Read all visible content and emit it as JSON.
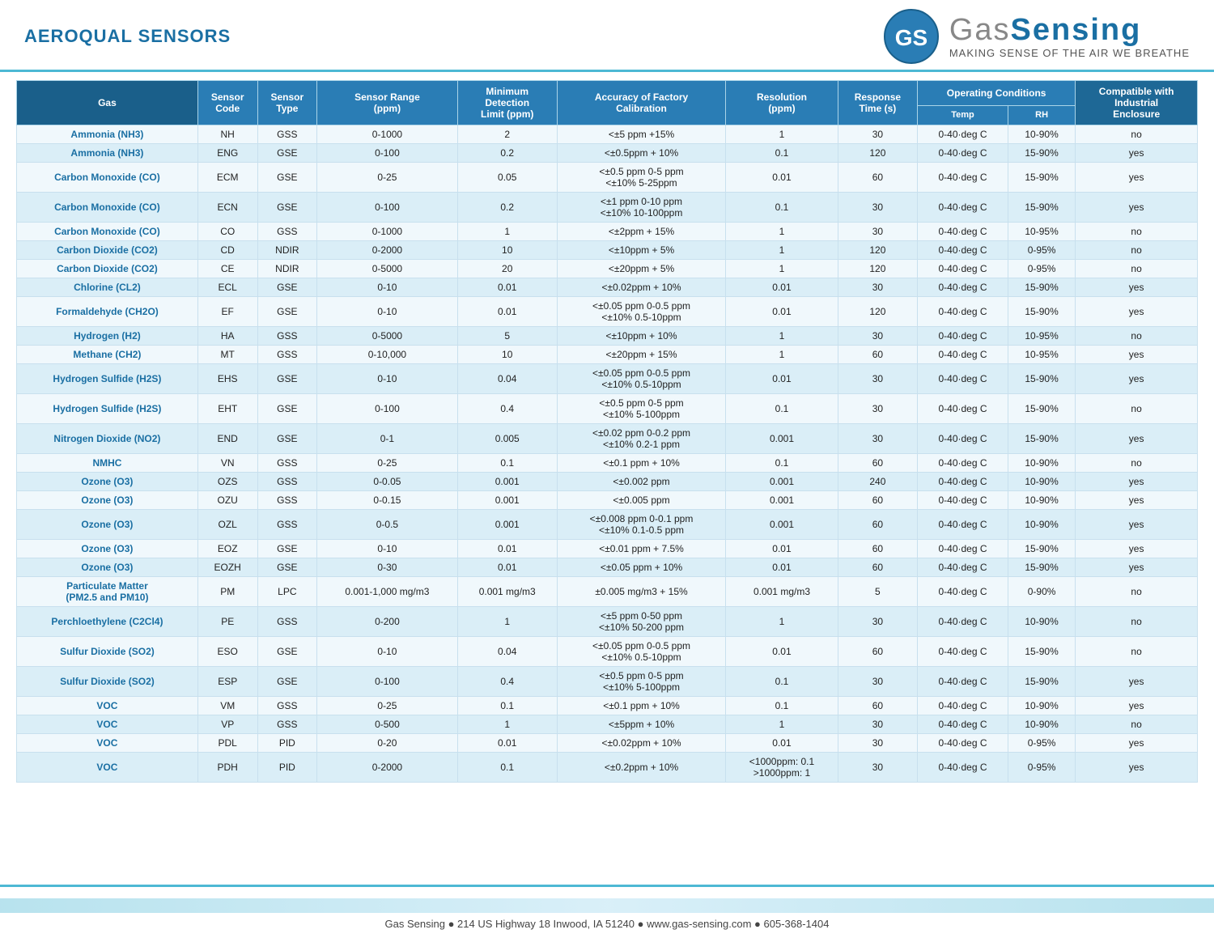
{
  "header": {
    "brand_title": "AEROQUAL SENSORS",
    "logo_gas": "Gas",
    "logo_sensing": "Sensing",
    "logo_gs": "GS",
    "logo_tagline": "MAKING SENSE OF THE AIR WE BREATHE"
  },
  "table": {
    "columns": {
      "gas": "Gas",
      "sensor_code": "Sensor Code",
      "sensor_type": "Sensor Type",
      "sensor_range": "Sensor Range (ppm)",
      "min_detection": "Minimum Detection Limit (ppm)",
      "accuracy": "Accuracy of Factory Calibration",
      "resolution": "Resolution (ppm)",
      "response_time": "Response Time (s)",
      "op_cond": "Operating Conditions",
      "temp": "Temp",
      "rh": "RH",
      "compatible": "Compatible with Industrial Enclosure"
    },
    "rows": [
      {
        "gas": "Ammonia (NH3)",
        "code": "NH",
        "type": "GSS",
        "range": "0-1000",
        "min_det": "2",
        "accuracy": "<±5 ppm +15%",
        "resolution": "1",
        "response": "30",
        "temp": "0-40·deg C",
        "rh": "10-90%",
        "compat": "no"
      },
      {
        "gas": "Ammonia (NH3)",
        "code": "ENG",
        "type": "GSE",
        "range": "0-100",
        "min_det": "0.2",
        "accuracy": "<±0.5ppm + 10%",
        "resolution": "0.1",
        "response": "120",
        "temp": "0-40·deg C",
        "rh": "15-90%",
        "compat": "yes"
      },
      {
        "gas": "Carbon Monoxide (CO)",
        "code": "ECM",
        "type": "GSE",
        "range": "0-25",
        "min_det": "0.05",
        "accuracy": "<±0.5 ppm 0-5 ppm\n<±10% 5-25ppm",
        "resolution": "0.01",
        "response": "60",
        "temp": "0-40·deg C",
        "rh": "15-90%",
        "compat": "yes"
      },
      {
        "gas": "Carbon Monoxide (CO)",
        "code": "ECN",
        "type": "GSE",
        "range": "0-100",
        "min_det": "0.2",
        "accuracy": "<±1 ppm 0-10 ppm\n<±10% 10-100ppm",
        "resolution": "0.1",
        "response": "30",
        "temp": "0-40·deg C",
        "rh": "15-90%",
        "compat": "yes"
      },
      {
        "gas": "Carbon Monoxide (CO)",
        "code": "CO",
        "type": "GSS",
        "range": "0-1000",
        "min_det": "1",
        "accuracy": "<±2ppm + 15%",
        "resolution": "1",
        "response": "30",
        "temp": "0-40·deg C",
        "rh": "10-95%",
        "compat": "no"
      },
      {
        "gas": "Carbon Dioxide (CO2)",
        "code": "CD",
        "type": "NDIR",
        "range": "0-2000",
        "min_det": "10",
        "accuracy": "<±10ppm + 5%",
        "resolution": "1",
        "response": "120",
        "temp": "0-40·deg C",
        "rh": "0-95%",
        "compat": "no"
      },
      {
        "gas": "Carbon Dioxide (CO2)",
        "code": "CE",
        "type": "NDIR",
        "range": "0-5000",
        "min_det": "20",
        "accuracy": "<±20ppm + 5%",
        "resolution": "1",
        "response": "120",
        "temp": "0-40·deg C",
        "rh": "0-95%",
        "compat": "no"
      },
      {
        "gas": "Chlorine (CL2)",
        "code": "ECL",
        "type": "GSE",
        "range": "0-10",
        "min_det": "0.01",
        "accuracy": "<±0.02ppm + 10%",
        "resolution": "0.01",
        "response": "30",
        "temp": "0-40·deg C",
        "rh": "15-90%",
        "compat": "yes"
      },
      {
        "gas": "Formaldehyde (CH2O)",
        "code": "EF",
        "type": "GSE",
        "range": "0-10",
        "min_det": "0.01",
        "accuracy": "<±0.05 ppm 0-0.5 ppm\n<±10% 0.5-10ppm",
        "resolution": "0.01",
        "response": "120",
        "temp": "0-40·deg C",
        "rh": "15-90%",
        "compat": "yes"
      },
      {
        "gas": "Hydrogen (H2)",
        "code": "HA",
        "type": "GSS",
        "range": "0-5000",
        "min_det": "5",
        "accuracy": "<±10ppm + 10%",
        "resolution": "1",
        "response": "30",
        "temp": "0-40·deg C",
        "rh": "10-95%",
        "compat": "no"
      },
      {
        "gas": "Methane (CH2)",
        "code": "MT",
        "type": "GSS",
        "range": "0-10,000",
        "min_det": "10",
        "accuracy": "<±20ppm + 15%",
        "resolution": "1",
        "response": "60",
        "temp": "0-40·deg C",
        "rh": "10-95%",
        "compat": "yes"
      },
      {
        "gas": "Hydrogen Sulfide (H2S)",
        "code": "EHS",
        "type": "GSE",
        "range": "0-10",
        "min_det": "0.04",
        "accuracy": "<±0.05 ppm 0-0.5 ppm\n<±10% 0.5-10ppm",
        "resolution": "0.01",
        "response": "30",
        "temp": "0-40·deg C",
        "rh": "15-90%",
        "compat": "yes"
      },
      {
        "gas": "Hydrogen Sulfide (H2S)",
        "code": "EHT",
        "type": "GSE",
        "range": "0-100",
        "min_det": "0.4",
        "accuracy": "<±0.5 ppm 0-5 ppm\n<±10% 5-100ppm",
        "resolution": "0.1",
        "response": "30",
        "temp": "0-40·deg C",
        "rh": "15-90%",
        "compat": "no"
      },
      {
        "gas": "Nitrogen Dioxide (NO2)",
        "code": "END",
        "type": "GSE",
        "range": "0-1",
        "min_det": "0.005",
        "accuracy": "<±0.02 ppm 0-0.2 ppm\n<±10% 0.2-1 ppm",
        "resolution": "0.001",
        "response": "30",
        "temp": "0-40·deg C",
        "rh": "15-90%",
        "compat": "yes"
      },
      {
        "gas": "NMHC",
        "code": "VN",
        "type": "GSS",
        "range": "0-25",
        "min_det": "0.1",
        "accuracy": "<±0.1 ppm + 10%",
        "resolution": "0.1",
        "response": "60",
        "temp": "0-40·deg C",
        "rh": "10-90%",
        "compat": "no"
      },
      {
        "gas": "Ozone (O3)",
        "code": "OZS",
        "type": "GSS",
        "range": "0-0.05",
        "min_det": "0.001",
        "accuracy": "<±0.002 ppm",
        "resolution": "0.001",
        "response": "240",
        "temp": "0-40·deg C",
        "rh": "10-90%",
        "compat": "yes"
      },
      {
        "gas": "Ozone (O3)",
        "code": "OZU",
        "type": "GSS",
        "range": "0-0.15",
        "min_det": "0.001",
        "accuracy": "<±0.005 ppm",
        "resolution": "0.001",
        "response": "60",
        "temp": "0-40·deg C",
        "rh": "10-90%",
        "compat": "yes"
      },
      {
        "gas": "Ozone (O3)",
        "code": "OZL",
        "type": "GSS",
        "range": "0-0.5",
        "min_det": "0.001",
        "accuracy": "<±0.008 ppm 0-0.1 ppm\n<±10% 0.1-0.5 ppm",
        "resolution": "0.001",
        "response": "60",
        "temp": "0-40·deg C",
        "rh": "10-90%",
        "compat": "yes"
      },
      {
        "gas": "Ozone (O3)",
        "code": "EOZ",
        "type": "GSE",
        "range": "0-10",
        "min_det": "0.01",
        "accuracy": "<±0.01 ppm + 7.5%",
        "resolution": "0.01",
        "response": "60",
        "temp": "0-40·deg C",
        "rh": "15-90%",
        "compat": "yes"
      },
      {
        "gas": "Ozone (O3)",
        "code": "EOZH",
        "type": "GSE",
        "range": "0-30",
        "min_det": "0.01",
        "accuracy": "<±0.05 ppm + 10%",
        "resolution": "0.01",
        "response": "60",
        "temp": "0-40·deg C",
        "rh": "15-90%",
        "compat": "yes"
      },
      {
        "gas": "Particulate Matter\n(PM2.5 and PM10)",
        "code": "PM",
        "type": "LPC",
        "range": "0.001-1,000 mg/m3",
        "min_det": "0.001 mg/m3",
        "accuracy": "±0.005 mg/m3 + 15%",
        "resolution": "0.001 mg/m3",
        "response": "5",
        "temp": "0-40·deg C",
        "rh": "0-90%",
        "compat": "no"
      },
      {
        "gas": "Perchloethylene (C2Cl4)",
        "code": "PE",
        "type": "GSS",
        "range": "0-200",
        "min_det": "1",
        "accuracy": "<±5 ppm 0-50 ppm\n<±10% 50-200 ppm",
        "resolution": "1",
        "response": "30",
        "temp": "0-40·deg C",
        "rh": "10-90%",
        "compat": "no"
      },
      {
        "gas": "Sulfur Dioxide (SO2)",
        "code": "ESO",
        "type": "GSE",
        "range": "0-10",
        "min_det": "0.04",
        "accuracy": "<±0.05 ppm 0-0.5 ppm\n<±10% 0.5-10ppm",
        "resolution": "0.01",
        "response": "60",
        "temp": "0-40·deg C",
        "rh": "15-90%",
        "compat": "no"
      },
      {
        "gas": "Sulfur Dioxide (SO2)",
        "code": "ESP",
        "type": "GSE",
        "range": "0-100",
        "min_det": "0.4",
        "accuracy": "<±0.5 ppm 0-5 ppm\n<±10% 5-100ppm",
        "resolution": "0.1",
        "response": "30",
        "temp": "0-40·deg C",
        "rh": "15-90%",
        "compat": "yes"
      },
      {
        "gas": "VOC",
        "code": "VM",
        "type": "GSS",
        "range": "0-25",
        "min_det": "0.1",
        "accuracy": "<±0.1 ppm + 10%",
        "resolution": "0.1",
        "response": "60",
        "temp": "0-40·deg C",
        "rh": "10-90%",
        "compat": "yes"
      },
      {
        "gas": "VOC",
        "code": "VP",
        "type": "GSS",
        "range": "0-500",
        "min_det": "1",
        "accuracy": "<±5ppm + 10%",
        "resolution": "1",
        "response": "30",
        "temp": "0-40·deg C",
        "rh": "10-90%",
        "compat": "no"
      },
      {
        "gas": "VOC",
        "code": "PDL",
        "type": "PID",
        "range": "0-20",
        "min_det": "0.01",
        "accuracy": "<±0.02ppm + 10%",
        "resolution": "0.01",
        "response": "30",
        "temp": "0-40·deg C",
        "rh": "0-95%",
        "compat": "yes"
      },
      {
        "gas": "VOC",
        "code": "PDH",
        "type": "PID",
        "range": "0-2000",
        "min_det": "0.1",
        "accuracy": "<±0.2ppm + 10%",
        "resolution": "<1000ppm: 0.1\n>1000ppm: 1",
        "response": "30",
        "temp": "0-40·deg C",
        "rh": "0-95%",
        "compat": "yes"
      }
    ]
  },
  "footer": {
    "text": "Gas Sensing ● 214 US Highway 18 Inwood, IA 51240 ● www.gas-sensing.com ● 605-368-1404"
  }
}
